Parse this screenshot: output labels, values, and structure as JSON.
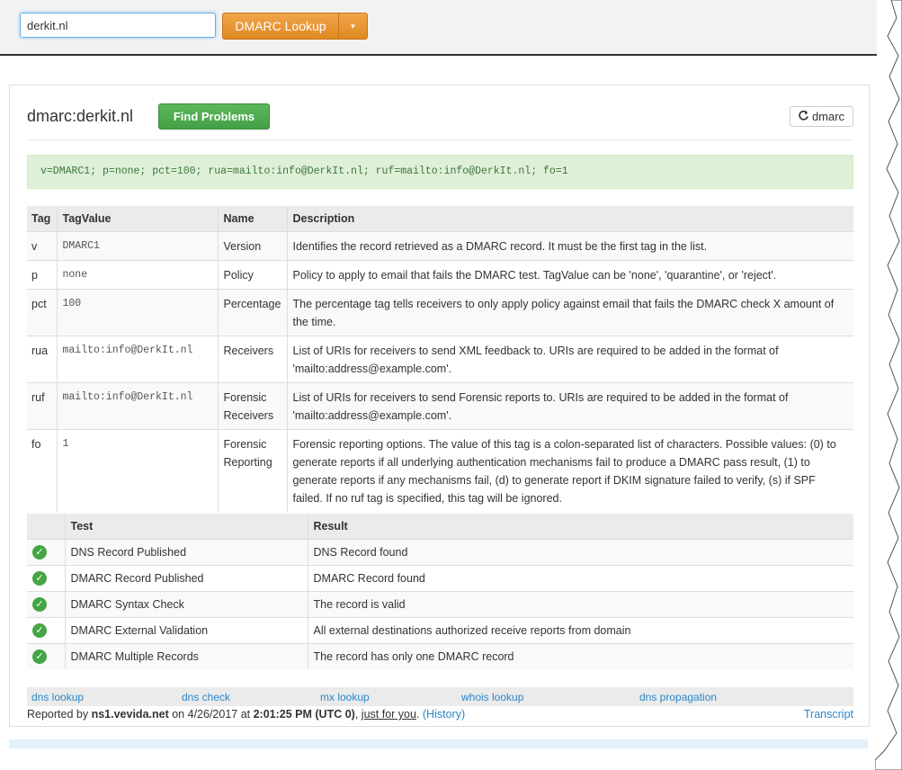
{
  "search": {
    "value": "derkit.nl"
  },
  "lookup_button": {
    "label": "DMARC Lookup",
    "caret": "▾"
  },
  "header": {
    "title": "dmarc:derkit.nl",
    "find_problems": "Find Problems",
    "refresh_label": "dmarc",
    "refresh_icon": "refresh-icon"
  },
  "record": "v=DMARC1; p=none; pct=100; rua=mailto:info@DerkIt.nl; ruf=mailto:info@DerkIt.nl; fo=1",
  "tag_table": {
    "columns": [
      "Tag",
      "TagValue",
      "Name",
      "Description"
    ],
    "rows": [
      {
        "tag": "v",
        "value": "DMARC1",
        "name": "Version",
        "desc": "Identifies the record retrieved as a DMARC record. It must be the first tag in the list."
      },
      {
        "tag": "p",
        "value": "none",
        "name": "Policy",
        "desc": "Policy to apply to email that fails the DMARC test. TagValue can be 'none', 'quarantine', or 'reject'."
      },
      {
        "tag": "pct",
        "value": "100",
        "name": "Percentage",
        "desc": "The percentage tag tells receivers to only apply policy against email that fails the DMARC check X amount of the time."
      },
      {
        "tag": "rua",
        "value": "mailto:info@DerkIt.nl",
        "name": "Receivers",
        "desc": "List of URIs for receivers to send XML feedback to. URIs are required to be added in the format of 'mailto:address@example.com'."
      },
      {
        "tag": "ruf",
        "value": "mailto:info@DerkIt.nl",
        "name": "Forensic Receivers",
        "desc": "List of URIs for receivers to send Forensic reports to. URIs are required to be added in the format of 'mailto:address@example.com'."
      },
      {
        "tag": "fo",
        "value": "1",
        "name": "Forensic Reporting",
        "desc": "Forensic reporting options. The value of this tag is a colon-separated list of characters. Possible values: (0) to generate reports if all underlying authentication mechanisms fail to produce a DMARC pass result, (1) to generate reports if any mechanisms fail, (d) to generate report if DKIM signature failed to verify, (s) if SPF failed. If no ruf tag is specified, this tag will be ignored."
      }
    ]
  },
  "test_table": {
    "columns": [
      "",
      "Test",
      "Result"
    ],
    "rows": [
      {
        "test": "DNS Record Published",
        "result": "DNS Record found"
      },
      {
        "test": "DMARC Record Published",
        "result": "DMARC Record found"
      },
      {
        "test": "DMARC Syntax Check",
        "result": "The record is valid"
      },
      {
        "test": "DMARC External Validation",
        "result": "All external destinations authorized receive reports from domain"
      },
      {
        "test": "DMARC Multiple Records",
        "result": "The record has only one DMARC record"
      }
    ]
  },
  "links": [
    "dns lookup",
    "dns check",
    "mx lookup",
    "whois lookup",
    "dns propagation"
  ],
  "footer": {
    "reported_by": "Reported by",
    "server": "ns1.vevida.net",
    "on": "on 4/26/2017 at",
    "time": "2:01:25 PM (UTC 0)",
    "just_for_you": "just for you",
    "history": "(History)",
    "transcript": "Transcript"
  },
  "colors": {
    "accent_orange": "#e8952e",
    "success_green": "#5cb85c",
    "link_blue": "#2a87c8",
    "record_bg": "#dff0d8"
  }
}
